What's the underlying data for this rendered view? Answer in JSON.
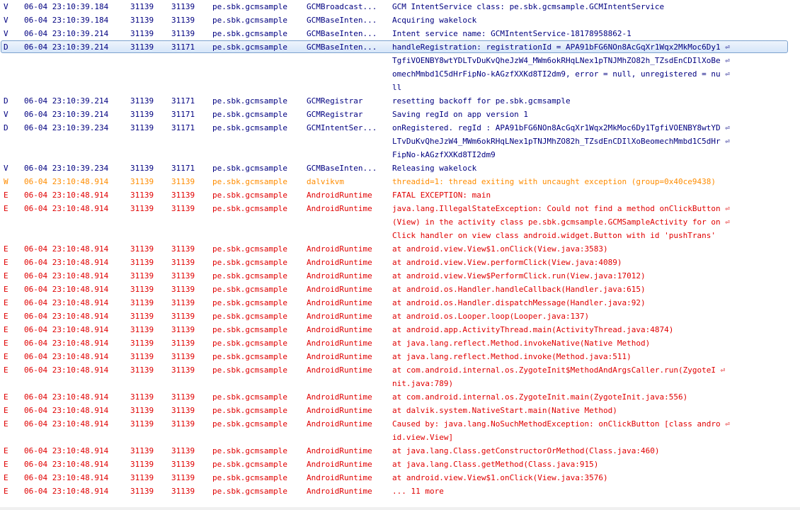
{
  "log": {
    "rows": [
      {
        "level": "V",
        "time": "06-04 23:10:39.184",
        "pid": "31139",
        "tid": "31139",
        "app": "pe.sbk.gcmsample",
        "tag": "GCMBroadcast...",
        "msg": [
          "GCM IntentService class: pe.sbk.gcmsample.GCMIntentService"
        ]
      },
      {
        "level": "V",
        "time": "06-04 23:10:39.184",
        "pid": "31139",
        "tid": "31139",
        "app": "pe.sbk.gcmsample",
        "tag": "GCMBaseInten...",
        "msg": [
          "Acquiring wakelock"
        ]
      },
      {
        "level": "V",
        "time": "06-04 23:10:39.214",
        "pid": "31139",
        "tid": "31139",
        "app": "pe.sbk.gcmsample",
        "tag": "GCMBaseInten...",
        "msg": [
          "Intent service name: GCMIntentService-18178958862-1"
        ]
      },
      {
        "level": "D",
        "time": "06-04 23:10:39.214",
        "pid": "31139",
        "tid": "31171",
        "app": "pe.sbk.gcmsample",
        "tag": "GCMBaseInten...",
        "selected": true,
        "msg": [
          "handleRegistration: registrationId = APA91bFG6NOn8AcGqXr1Wqx2MkMoc6Dy1 ⏎",
          "TgfiVOENBY8wtYDLTvDuKvQheJzW4_MWm6okRHqLNex1pTNJMhZO82h_TZsdEnCDIlXoBe ⏎",
          "omechMmbd1C5dHrFipNo-kAGzfXXKd8TI2dm9, error = null, unregistered = nu ⏎",
          "ll"
        ]
      },
      {
        "level": "D",
        "time": "06-04 23:10:39.214",
        "pid": "31139",
        "tid": "31171",
        "app": "pe.sbk.gcmsample",
        "tag": "GCMRegistrar",
        "msg": [
          "resetting backoff for pe.sbk.gcmsample"
        ]
      },
      {
        "level": "V",
        "time": "06-04 23:10:39.214",
        "pid": "31139",
        "tid": "31171",
        "app": "pe.sbk.gcmsample",
        "tag": "GCMRegistrar",
        "msg": [
          "Saving regId on app version 1"
        ]
      },
      {
        "level": "D",
        "time": "06-04 23:10:39.234",
        "pid": "31139",
        "tid": "31171",
        "app": "pe.sbk.gcmsample",
        "tag": "GCMIntentSer...",
        "msg": [
          "onRegistered. regId : APA91bFG6NOn8AcGqXr1Wqx2MkMoc6Dy1TgfiVOENBY8wtYD ⏎",
          "LTvDuKvQheJzW4_MWm6okRHqLNex1pTNJMhZO82h_TZsdEnCDIlXoBeomechMmbd1C5dHr ⏎",
          "FipNo-kAGzfXXKd8TI2dm9"
        ]
      },
      {
        "level": "V",
        "time": "06-04 23:10:39.234",
        "pid": "31139",
        "tid": "31171",
        "app": "pe.sbk.gcmsample",
        "tag": "GCMBaseInten...",
        "msg": [
          "Releasing wakelock"
        ]
      },
      {
        "level": "W",
        "time": "06-04 23:10:48.914",
        "pid": "31139",
        "tid": "31139",
        "app": "pe.sbk.gcmsample",
        "tag": "dalvikvm",
        "msg": [
          "threadid=1: thread exiting with uncaught exception (group=0x40ce9438)"
        ]
      },
      {
        "level": "E",
        "time": "06-04 23:10:48.914",
        "pid": "31139",
        "tid": "31139",
        "app": "pe.sbk.gcmsample",
        "tag": "AndroidRuntime",
        "msg": [
          "FATAL EXCEPTION: main"
        ]
      },
      {
        "level": "E",
        "time": "06-04 23:10:48.914",
        "pid": "31139",
        "tid": "31139",
        "app": "pe.sbk.gcmsample",
        "tag": "AndroidRuntime",
        "msg": [
          "java.lang.IllegalStateException: Could not find a method onClickButton ⏎",
          "(View) in the activity class pe.sbk.gcmsample.GCMSampleActivity for on ⏎",
          "Click handler on view class android.widget.Button with id 'pushTrans'"
        ]
      },
      {
        "level": "E",
        "time": "06-04 23:10:48.914",
        "pid": "31139",
        "tid": "31139",
        "app": "pe.sbk.gcmsample",
        "tag": "AndroidRuntime",
        "msg": [
          "at android.view.View$1.onClick(View.java:3583)"
        ]
      },
      {
        "level": "E",
        "time": "06-04 23:10:48.914",
        "pid": "31139",
        "tid": "31139",
        "app": "pe.sbk.gcmsample",
        "tag": "AndroidRuntime",
        "msg": [
          "at android.view.View.performClick(View.java:4089)"
        ]
      },
      {
        "level": "E",
        "time": "06-04 23:10:48.914",
        "pid": "31139",
        "tid": "31139",
        "app": "pe.sbk.gcmsample",
        "tag": "AndroidRuntime",
        "msg": [
          "at android.view.View$PerformClick.run(View.java:17012)"
        ]
      },
      {
        "level": "E",
        "time": "06-04 23:10:48.914",
        "pid": "31139",
        "tid": "31139",
        "app": "pe.sbk.gcmsample",
        "tag": "AndroidRuntime",
        "msg": [
          "at android.os.Handler.handleCallback(Handler.java:615)"
        ]
      },
      {
        "level": "E",
        "time": "06-04 23:10:48.914",
        "pid": "31139",
        "tid": "31139",
        "app": "pe.sbk.gcmsample",
        "tag": "AndroidRuntime",
        "msg": [
          "at android.os.Handler.dispatchMessage(Handler.java:92)"
        ]
      },
      {
        "level": "E",
        "time": "06-04 23:10:48.914",
        "pid": "31139",
        "tid": "31139",
        "app": "pe.sbk.gcmsample",
        "tag": "AndroidRuntime",
        "msg": [
          "at android.os.Looper.loop(Looper.java:137)"
        ]
      },
      {
        "level": "E",
        "time": "06-04 23:10:48.914",
        "pid": "31139",
        "tid": "31139",
        "app": "pe.sbk.gcmsample",
        "tag": "AndroidRuntime",
        "msg": [
          "at android.app.ActivityThread.main(ActivityThread.java:4874)"
        ]
      },
      {
        "level": "E",
        "time": "06-04 23:10:48.914",
        "pid": "31139",
        "tid": "31139",
        "app": "pe.sbk.gcmsample",
        "tag": "AndroidRuntime",
        "msg": [
          "at java.lang.reflect.Method.invokeNative(Native Method)"
        ]
      },
      {
        "level": "E",
        "time": "06-04 23:10:48.914",
        "pid": "31139",
        "tid": "31139",
        "app": "pe.sbk.gcmsample",
        "tag": "AndroidRuntime",
        "msg": [
          "at java.lang.reflect.Method.invoke(Method.java:511)"
        ]
      },
      {
        "level": "E",
        "time": "06-04 23:10:48.914",
        "pid": "31139",
        "tid": "31139",
        "app": "pe.sbk.gcmsample",
        "tag": "AndroidRuntime",
        "msg": [
          "at com.android.internal.os.ZygoteInit$MethodAndArgsCaller.run(ZygoteI ⏎",
          "nit.java:789)"
        ]
      },
      {
        "level": "E",
        "time": "06-04 23:10:48.914",
        "pid": "31139",
        "tid": "31139",
        "app": "pe.sbk.gcmsample",
        "tag": "AndroidRuntime",
        "msg": [
          "at com.android.internal.os.ZygoteInit.main(ZygoteInit.java:556)"
        ]
      },
      {
        "level": "E",
        "time": "06-04 23:10:48.914",
        "pid": "31139",
        "tid": "31139",
        "app": "pe.sbk.gcmsample",
        "tag": "AndroidRuntime",
        "msg": [
          "at dalvik.system.NativeStart.main(Native Method)"
        ]
      },
      {
        "level": "E",
        "time": "06-04 23:10:48.914",
        "pid": "31139",
        "tid": "31139",
        "app": "pe.sbk.gcmsample",
        "tag": "AndroidRuntime",
        "msg": [
          "Caused by: java.lang.NoSuchMethodException: onClickButton [class andro ⏎",
          "id.view.View]"
        ]
      },
      {
        "level": "E",
        "time": "06-04 23:10:48.914",
        "pid": "31139",
        "tid": "31139",
        "app": "pe.sbk.gcmsample",
        "tag": "AndroidRuntime",
        "msg": [
          "at java.lang.Class.getConstructorOrMethod(Class.java:460)"
        ]
      },
      {
        "level": "E",
        "time": "06-04 23:10:48.914",
        "pid": "31139",
        "tid": "31139",
        "app": "pe.sbk.gcmsample",
        "tag": "AndroidRuntime",
        "msg": [
          "at java.lang.Class.getMethod(Class.java:915)"
        ]
      },
      {
        "level": "E",
        "time": "06-04 23:10:48.914",
        "pid": "31139",
        "tid": "31139",
        "app": "pe.sbk.gcmsample",
        "tag": "AndroidRuntime",
        "msg": [
          "at android.view.View$1.onClick(View.java:3576)"
        ]
      },
      {
        "level": "E",
        "time": "06-04 23:10:48.914",
        "pid": "31139",
        "tid": "31139",
        "app": "pe.sbk.gcmsample",
        "tag": "AndroidRuntime",
        "msg": [
          "... 11 more"
        ]
      }
    ]
  },
  "colors": {
    "verbose": "#000080",
    "debug": "#000080",
    "warn": "#ff8c00",
    "error": "#e00000",
    "selection_border": "#7da2ce"
  }
}
